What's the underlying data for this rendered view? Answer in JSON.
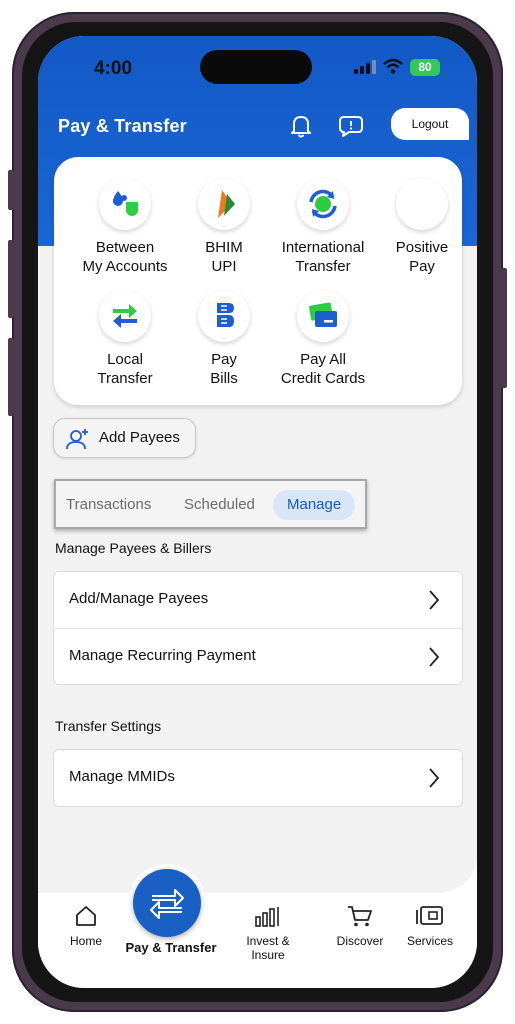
{
  "status_bar": {
    "time": "4:00",
    "battery": "80"
  },
  "header": {
    "title": "Pay & Transfer",
    "logout_label": "Logout"
  },
  "quick_actions": [
    {
      "label": "Between\nMy Accounts",
      "icon": "between-accounts-icon"
    },
    {
      "label": "BHIM\nUPI",
      "icon": "bhim-upi-icon"
    },
    {
      "label": "International\nTransfer",
      "icon": "international-transfer-icon"
    },
    {
      "label": "Positive\nPay",
      "icon": "positive-pay-icon"
    },
    {
      "label": "Local\nTransfer",
      "icon": "local-transfer-icon"
    },
    {
      "label": "Pay\nBills",
      "icon": "pay-bills-icon"
    },
    {
      "label": "Pay All\nCredit Cards",
      "icon": "credit-card-icon"
    }
  ],
  "add_payees_label": "Add Payees",
  "tabs": [
    {
      "label": "Transactions",
      "active": false
    },
    {
      "label": "Scheduled",
      "active": false
    },
    {
      "label": "Manage",
      "active": true
    }
  ],
  "manage_section": {
    "title": "Manage Payees & Billers",
    "items": [
      "Add/Manage Payees",
      "Manage Recurring Payment"
    ]
  },
  "settings_section": {
    "title": "Transfer Settings",
    "items": [
      "Manage MMIDs"
    ]
  },
  "bottom_nav": {
    "items": [
      {
        "label": "Home",
        "icon": "home-icon"
      },
      {
        "label": "Pay & Transfer",
        "icon": "transfer-arrows-icon",
        "active": true
      },
      {
        "label": "Invest & Insure",
        "icon": "bar-chart-icon"
      },
      {
        "label": "Discover",
        "icon": "cart-icon"
      },
      {
        "label": "Services",
        "icon": "services-card-icon"
      }
    ]
  },
  "colors": {
    "brand_blue": "#1a5fc4",
    "active_tab_bg": "#d8e6f8",
    "battery_green": "#36c759"
  }
}
